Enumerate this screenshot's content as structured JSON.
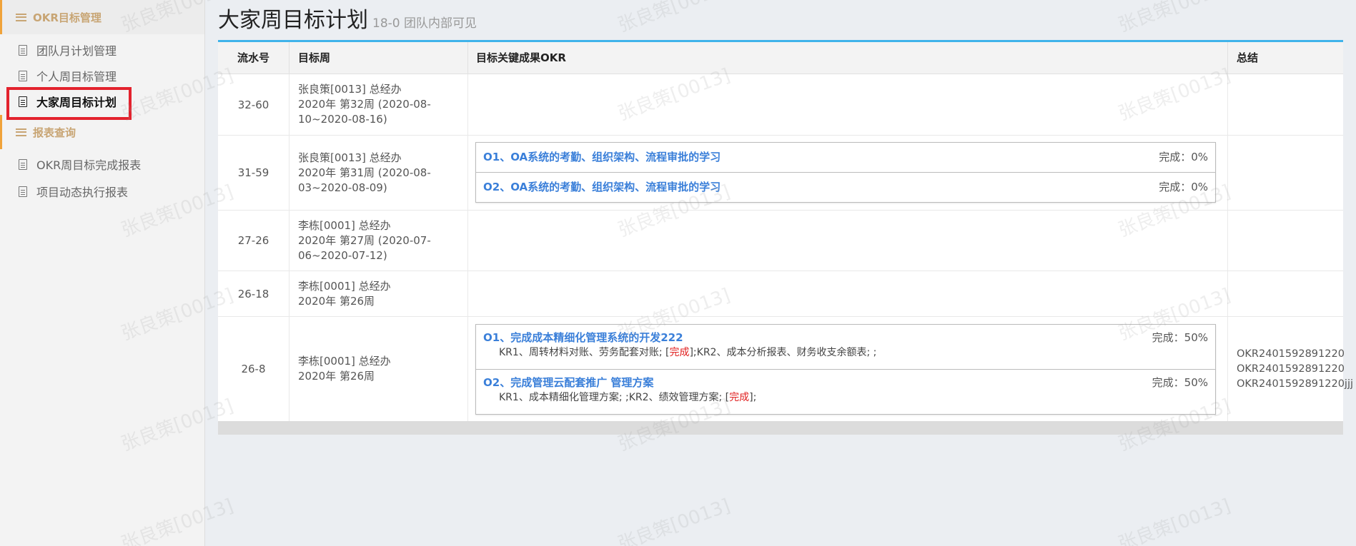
{
  "sidebar": {
    "group1": "OKR目标管理",
    "group2": "报表查询",
    "items": [
      {
        "label": "团队月计划管理"
      },
      {
        "label": "个人周目标管理"
      },
      {
        "label": "大家周目标计划"
      },
      {
        "label": "OKR周目标完成报表"
      },
      {
        "label": "项目动态执行报表"
      }
    ]
  },
  "header": {
    "title": "大家周目标计划",
    "subtitle": "18-0 团队内部可见"
  },
  "table": {
    "headers": [
      "流水号",
      "目标周",
      "目标关键成果OKR",
      "总结"
    ],
    "rows": [
      {
        "id": "32-60",
        "owner": "张良策[0013] 总经办",
        "week1": "2020年 第32周 (2020-08-",
        "week2": "10~2020-08-16)"
      },
      {
        "id": "31-59",
        "owner": "张良策[0013] 总经办",
        "week1": "2020年 第31周 (2020-08-",
        "week2": "03~2020-08-09)",
        "okrs": [
          {
            "title": "O1、OA系统的考勤、组织架构、流程审批的学习",
            "status": "完成：0%"
          },
          {
            "title": "O2、OA系统的考勤、组织架构、流程审批的学习",
            "status": "完成：0%"
          }
        ]
      },
      {
        "id": "27-26",
        "owner": "李栋[0001] 总经办",
        "week1": "2020年 第27周 (2020-07-",
        "week2": "06~2020-07-12)"
      },
      {
        "id": "26-18",
        "owner": "李栋[0001] 总经办",
        "week1": "2020年 第26周"
      },
      {
        "id": "26-8",
        "owner": "李栋[0001] 总经办",
        "week1": "2020年 第26周",
        "okrs": [
          {
            "title": "O1、完成成本精细化管理系统的开发222",
            "status": "完成：50%",
            "kr_a": "KR1、周转材料对账、劳务配套对账; [",
            "kr_done": "完成",
            "kr_b": "];KR2、成本分析报表、财务收支余额表; ;"
          },
          {
            "title": "O2、完成管理云配套推广 管理方案",
            "status": "完成：50%",
            "kr_a": "KR1、成本精细化管理方案; ;KR2、绩效管理方案; [",
            "kr_done": "完成",
            "kr_b": "];"
          }
        ],
        "summary": [
          "OKR2401592891220",
          "OKR2401592891220",
          "OKR2401592891220jjj"
        ]
      }
    ]
  },
  "watermark": "张良策[0013]",
  "colors": {
    "accent": "#3fb3ea",
    "link": "#3a7fd9",
    "highlight": "#e3222d",
    "sidebar_head": "#c8a574"
  }
}
